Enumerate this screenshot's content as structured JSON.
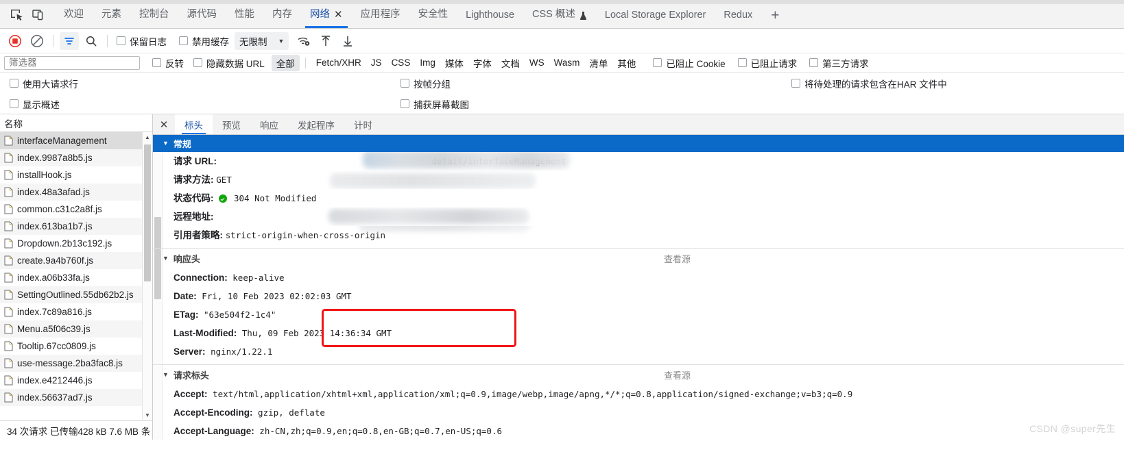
{
  "devtools_tabs": {
    "dock_icons": [
      "inspect-element-icon",
      "device-toolbar-icon"
    ],
    "items": [
      {
        "label": "欢迎",
        "selected": false
      },
      {
        "label": "元素",
        "selected": false
      },
      {
        "label": "控制台",
        "selected": false
      },
      {
        "label": "源代码",
        "selected": false
      },
      {
        "label": "性能",
        "selected": false
      },
      {
        "label": "内存",
        "selected": false
      },
      {
        "label": "网络",
        "selected": true,
        "closable": true
      },
      {
        "label": "应用程序",
        "selected": false
      },
      {
        "label": "安全性",
        "selected": false
      },
      {
        "label": "Lighthouse",
        "selected": false
      },
      {
        "label": "CSS 概述",
        "selected": false,
        "experimental": true
      },
      {
        "label": "Local Storage Explorer",
        "selected": false
      },
      {
        "label": "Redux",
        "selected": false
      }
    ],
    "add_tab_label": "+"
  },
  "toolbar": {
    "record_title": "record-button",
    "clear_title": "clear-button",
    "filter_title": "filter-button",
    "search_title": "search-button",
    "preserve_log": "保留日志",
    "disable_cache": "禁用缓存",
    "throttling": "无限制",
    "throttle_caret": "▼",
    "network_conditions_title": "network-conditions",
    "import_har_title": "import-har",
    "export_har_title": "export-har"
  },
  "filter_bar": {
    "placeholder": "筛选器",
    "value": "",
    "invert": "反转",
    "hide_data_urls": "隐藏数据 URL",
    "types": [
      "全部",
      "Fetch/XHR",
      "JS",
      "CSS",
      "Img",
      "媒体",
      "字体",
      "文档",
      "WS",
      "Wasm",
      "清单",
      "其他"
    ],
    "selected_type": "全部",
    "blocked_cookies": "已阻止 Cookie",
    "blocked_requests": "已阻止请求",
    "third_party": "第三方请求"
  },
  "options": {
    "big_request_rows": "使用大请求行",
    "group_by_frame": "按帧分组",
    "include_pending_har": "将待处理的请求包含在HAR 文件中",
    "show_overview": "显示概述",
    "capture_screenshots": "捕获屏幕截图"
  },
  "request_list": {
    "header": "名称",
    "items": [
      {
        "name": "interfaceManagement",
        "selected": true
      },
      {
        "name": "index.9987a8b5.js",
        "selected": false
      },
      {
        "name": "installHook.js",
        "selected": false
      },
      {
        "name": "index.48a3afad.js",
        "selected": false
      },
      {
        "name": "common.c31c2a8f.js",
        "selected": false
      },
      {
        "name": "index.613ba1b7.js",
        "selected": false
      },
      {
        "name": "Dropdown.2b13c192.js",
        "selected": false
      },
      {
        "name": "create.9a4b760f.js",
        "selected": false
      },
      {
        "name": "index.a06b33fa.js",
        "selected": false
      },
      {
        "name": "SettingOutlined.55db62b2.js",
        "selected": false
      },
      {
        "name": "index.7c89a816.js",
        "selected": false
      },
      {
        "name": "Menu.a5f06c39.js",
        "selected": false
      },
      {
        "name": "Tooltip.67cc0809.js",
        "selected": false
      },
      {
        "name": "use-message.2ba3fac8.js",
        "selected": false
      },
      {
        "name": "index.e4212446.js",
        "selected": false
      },
      {
        "name": "index.56637ad7.js",
        "selected": false
      }
    ],
    "status_bar": "34 次请求  已传输428 kB  7.6 MB 条"
  },
  "detail": {
    "close_label": "✕",
    "tabs": [
      {
        "label": "标头",
        "selected": true
      },
      {
        "label": "预览",
        "selected": false
      },
      {
        "label": "响应",
        "selected": false
      },
      {
        "label": "发起程序",
        "selected": false
      },
      {
        "label": "计时",
        "selected": false
      }
    ],
    "general": {
      "title": "常规",
      "request_url_label": "请求 URL:",
      "request_url_value": "detail/interfaceManagement",
      "request_method_label": "请求方法:",
      "request_method_value": "GET",
      "status_code_label": "状态代码:",
      "status_code_value": "304 Not Modified",
      "status_icon": "green-check-icon",
      "remote_address_label": "远程地址:",
      "referrer_policy_label": "引用者策略:",
      "referrer_policy_value": "strict-origin-when-cross-origin"
    },
    "response_headers": {
      "title": "响应头",
      "view_source": "查看源",
      "rows": [
        {
          "name": "Connection:",
          "value": "keep-alive"
        },
        {
          "name": "Date:",
          "value": "Fri, 10 Feb 2023 02:02:03 GMT"
        },
        {
          "name": "ETag:",
          "value": "\"63e504f2-1c4\""
        },
        {
          "name": "Last-Modified:",
          "value": "Thu, 09 Feb 2023 14:36:34 GMT"
        },
        {
          "name": "Server:",
          "value": "nginx/1.22.1"
        }
      ]
    },
    "request_headers": {
      "title": "请求标头",
      "view_source": "查看源",
      "rows": [
        {
          "name": "Accept:",
          "value": "text/html,application/xhtml+xml,application/xml;q=0.9,image/webp,image/apng,*/*;q=0.8,application/signed-exchange;v=b3;q=0.9"
        },
        {
          "name": "Accept-Encoding:",
          "value": "gzip, deflate"
        },
        {
          "name": "Accept-Language:",
          "value": "zh-CN,zh;q=0.9,en;q=0.8,en-GB;q=0.7,en-US;q=0.6"
        }
      ]
    }
  },
  "watermark": "CSDN @super先生",
  "colors": {
    "accent": "#1a73e8",
    "section_header": "#0b6ac8",
    "record_red": "#e8332a",
    "status_ok": "#11a60a",
    "annotation_red": "#f01414"
  }
}
